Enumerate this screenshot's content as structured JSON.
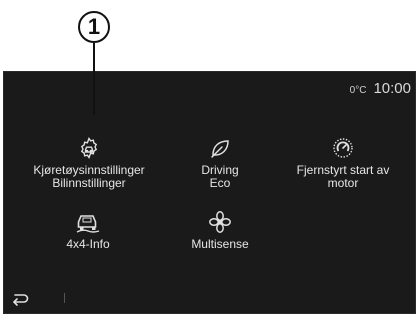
{
  "callout": {
    "number": "1"
  },
  "status": {
    "temperature": "0°C",
    "time": "10:00"
  },
  "tiles": [
    {
      "label": "Kjøretøysinnstillinger\nBilinnstillinger",
      "icon": "car-settings-icon"
    },
    {
      "label": "Driving\nEco",
      "icon": "eco-leaf-icon"
    },
    {
      "label": "Fjernstyrt start av\nmotor",
      "icon": "remote-start-icon"
    },
    {
      "label": "4x4-Info",
      "icon": "4x4-info-icon"
    },
    {
      "label": "Multisense",
      "icon": "multisense-icon"
    }
  ],
  "bottom": {
    "back_icon": "back-arrow-icon"
  },
  "colors": {
    "screen_bg": "#1a1a1a",
    "text": "#e6e6e6",
    "icon": "#e0e0e0"
  }
}
